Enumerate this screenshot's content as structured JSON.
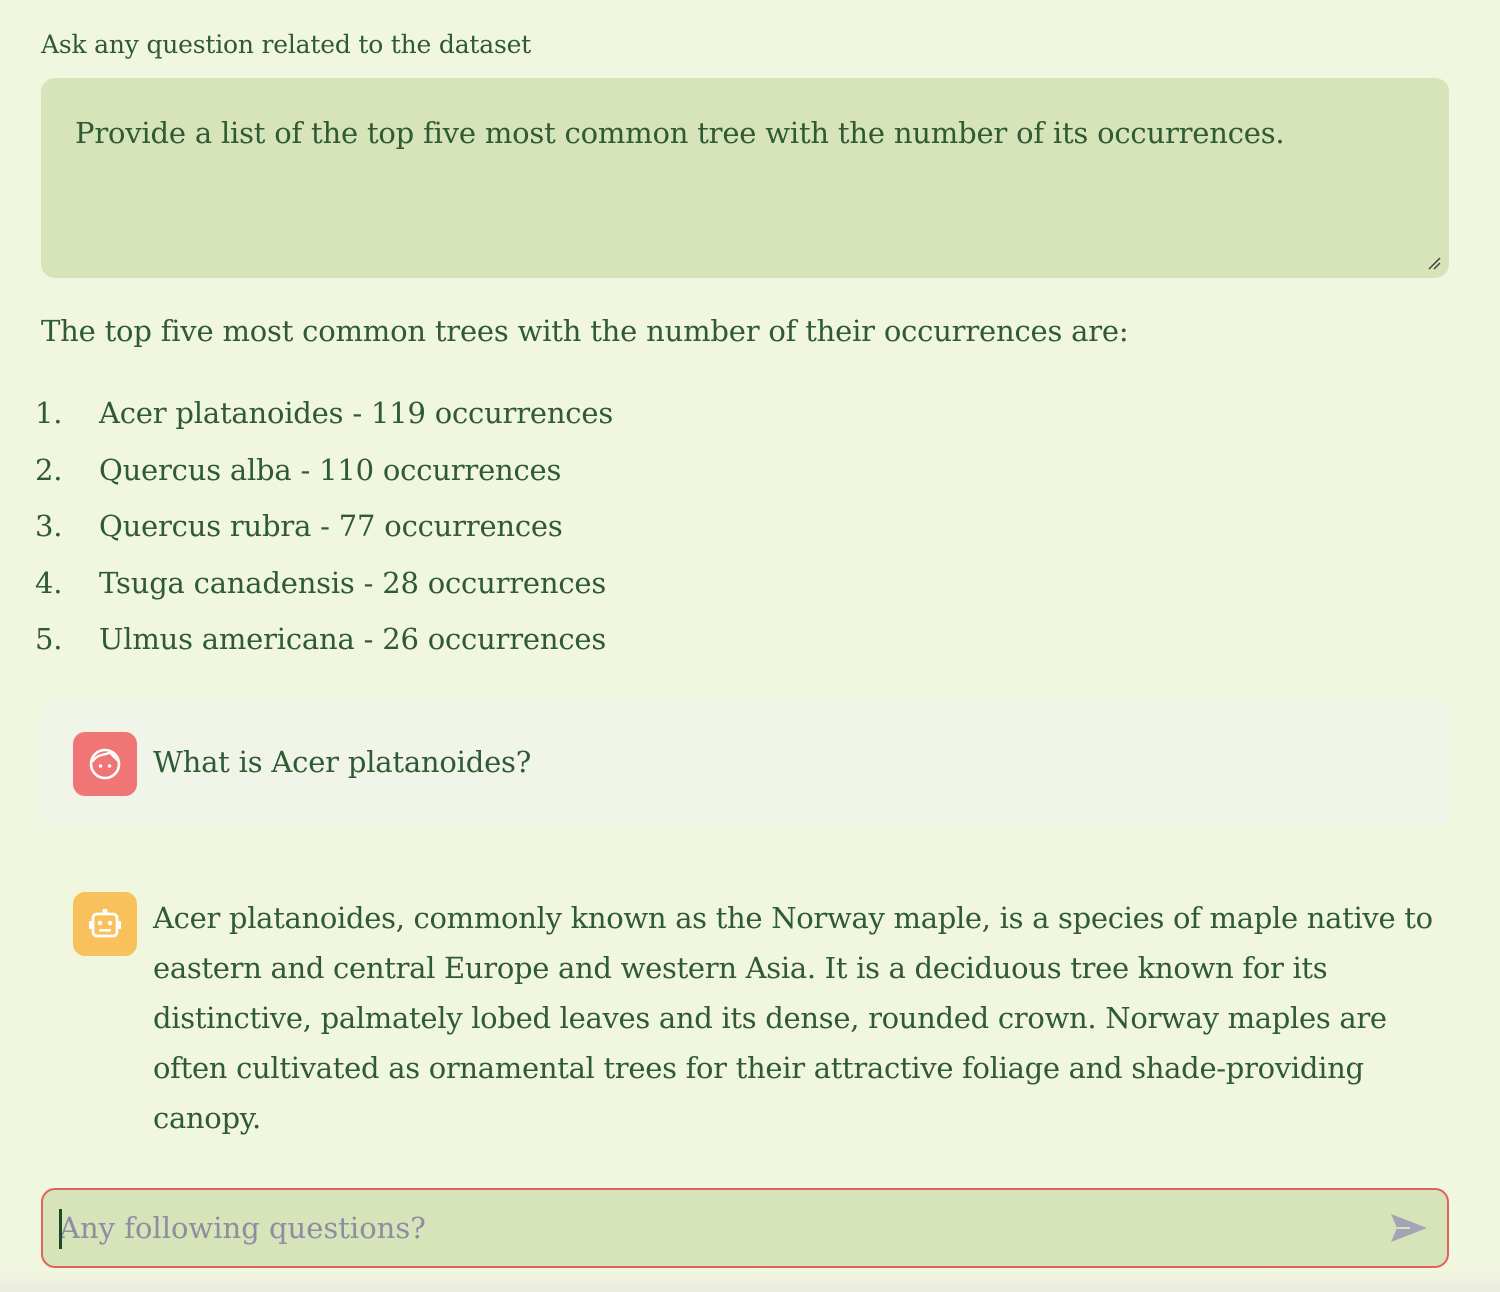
{
  "question": {
    "label": "Ask any question related to the dataset",
    "value": "Provide a list of the top five most common tree with the number of its occurrences."
  },
  "answer": {
    "intro": "The top five most common trees with the number of their occurrences are:",
    "items": [
      {
        "num": "1.",
        "text": "Acer platanoides - 119 occurrences"
      },
      {
        "num": "2.",
        "text": "Quercus alba - 110 occurrences"
      },
      {
        "num": "3.",
        "text": "Quercus rubra - 77 occurrences"
      },
      {
        "num": "4.",
        "text": "Tsuga canadensis - 28 occurrences"
      },
      {
        "num": "5.",
        "text": "Ulmus americana - 26 occurrences"
      }
    ]
  },
  "chat": {
    "user_message": "What is Acer platanoides?",
    "user_icon": "user-face-icon",
    "bot_icon": "robot-icon",
    "bot_message": "Acer platanoides, commonly known as the Norway maple, is a species of maple native to eastern and central Europe and western Asia. It is a deciduous tree known for its distinctive, palmately lobed leaves and its dense, rounded crown. Norway maples are often cultivated as ornamental trees for their attractive foliage and shade-providing canopy."
  },
  "followup": {
    "placeholder": "Any following questions?",
    "value": "",
    "send_icon": "send-icon"
  },
  "colors": {
    "background": "#f1f6df",
    "text": "#2e5a34",
    "input_bg": "#d7e3b8",
    "user_avatar": "#ef7674",
    "bot_avatar": "#f8c15c",
    "focus_border": "#e0625e"
  }
}
